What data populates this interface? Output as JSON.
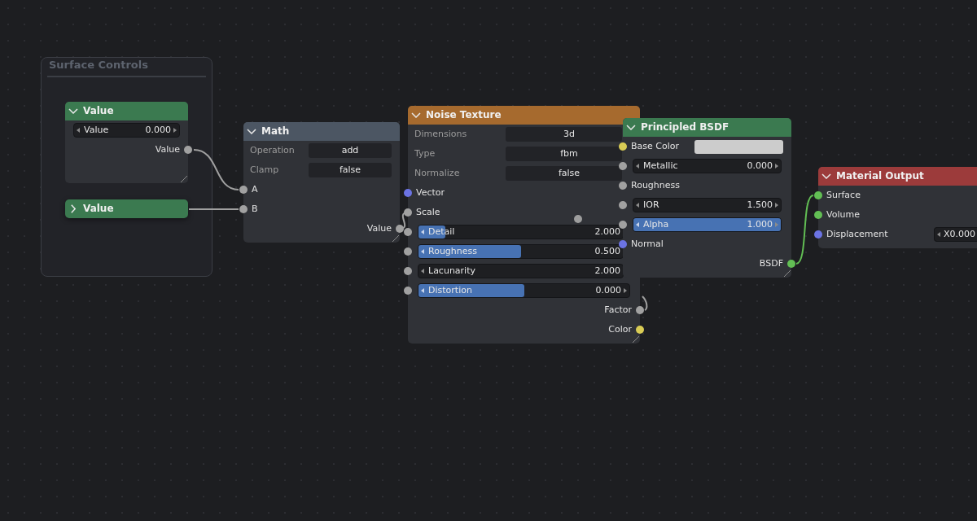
{
  "frame": {
    "title": "Surface Controls"
  },
  "nodes": [
    {
      "title": "Value",
      "color": "#3b7a50",
      "expanded": true,
      "rows": [
        {
          "kind": "field",
          "label": "Value",
          "value": "0.000"
        },
        {
          "kind": "output",
          "label": "Value",
          "color": "#a1a1a1"
        }
      ]
    },
    {
      "title": "Value",
      "color": "#3b7a50",
      "expanded": false
    },
    {
      "title": "Math",
      "color": "#4c5663",
      "expanded": true,
      "rows": [
        {
          "kind": "property",
          "label": "Operation",
          "value": "add"
        },
        {
          "kind": "property",
          "label": "Clamp",
          "value": "false"
        },
        {
          "kind": "input",
          "label": "A",
          "color": "#a1a1a1"
        },
        {
          "kind": "input",
          "label": "B",
          "color": "#a1a1a1"
        },
        {
          "kind": "output",
          "label": "Value",
          "color": "#a1a1a1"
        }
      ]
    },
    {
      "title": "Noise Texture",
      "color": "#a66a2e",
      "expanded": true,
      "rows": [
        {
          "kind": "property",
          "label": "Dimensions",
          "value": "3d"
        },
        {
          "kind": "property",
          "label": "Type",
          "value": "fbm"
        },
        {
          "kind": "property",
          "label": "Normalize",
          "value": "false"
        },
        {
          "kind": "input",
          "label": "Vector",
          "color": "#6b73e3"
        },
        {
          "kind": "input",
          "label": "Scale",
          "color": "#a1a1a1"
        },
        {
          "kind": "slider",
          "label": "Detail",
          "value": "2.000",
          "level": 0.13,
          "color": "#a1a1a1"
        },
        {
          "kind": "slider",
          "label": "Roughness",
          "value": "0.500",
          "level": 0.5,
          "color": "#a1a1a1"
        },
        {
          "kind": "slider",
          "label": "Lacunarity",
          "value": "2.000",
          "color": "#a1a1a1"
        },
        {
          "kind": "slider",
          "label": "Distortion",
          "value": "0.000",
          "level": 0.5,
          "color": "#a1a1a1"
        },
        {
          "kind": "output",
          "label": "Factor",
          "color": "#a1a1a1"
        },
        {
          "kind": "output",
          "label": "Color",
          "color": "#d9cc55"
        }
      ]
    },
    {
      "title": "Principled BSDF",
      "color": "#3b7a50",
      "expanded": true,
      "rows": [
        {
          "kind": "color_input",
          "label": "Base Color",
          "color": "#d9cc55",
          "swatch": {
            "color": "#cccccc"
          }
        },
        {
          "kind": "slider",
          "label": "Metallic",
          "value": "0.000",
          "color": "#a1a1a1"
        },
        {
          "kind": "input",
          "label": "Roughness",
          "color": "#a1a1a1"
        },
        {
          "kind": "slider",
          "label": "IOR",
          "value": "1.500",
          "color": "#a1a1a1"
        },
        {
          "kind": "slider",
          "label": "Alpha",
          "value": "1.000",
          "level": 1,
          "color": "#a1a1a1"
        },
        {
          "kind": "input",
          "label": "Normal",
          "color": "#6b73e3"
        },
        {
          "kind": "output",
          "label": "BSDF",
          "color": "#62be54"
        }
      ]
    },
    {
      "title": "Material Output",
      "color": "#9c3b3b",
      "expanded": true,
      "rows": [
        {
          "kind": "input",
          "label": "Surface",
          "color": "#62be54"
        },
        {
          "kind": "input",
          "label": "Volume",
          "color": "#62be54"
        },
        {
          "kind": "vector_input",
          "label": "Displacement",
          "value": "X0.000",
          "color": "#6b73e3"
        }
      ]
    }
  ]
}
